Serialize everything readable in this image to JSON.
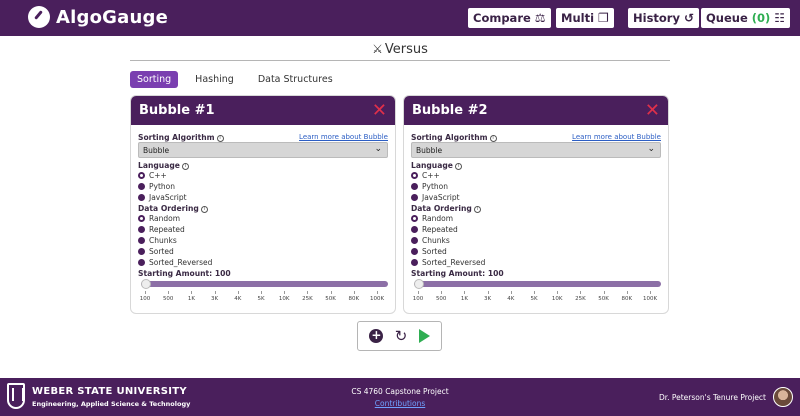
{
  "header": {
    "brand": "AlgoGauge",
    "nav": [
      {
        "label": "Compare",
        "icon": "scale-icon"
      },
      {
        "label": "Multi",
        "icon": "copy-icon"
      },
      {
        "label": "History",
        "icon": "history-icon"
      },
      {
        "label": "Queue",
        "count": "(0)",
        "icon": "queue-icon"
      }
    ]
  },
  "versus": {
    "label": "Versus",
    "icon": "swords-icon"
  },
  "tabs": [
    {
      "label": "Sorting",
      "active": true
    },
    {
      "label": "Hashing",
      "active": false
    },
    {
      "label": "Data Structures",
      "active": false
    }
  ],
  "cards": [
    {
      "title": "Bubble #1",
      "algorithm_label": "Sorting Algorithm",
      "learn_more": "Learn more about Bubble",
      "algorithm_value": "Bubble",
      "language_label": "Language",
      "languages": [
        "C++",
        "Python",
        "JavaScript"
      ],
      "selected_language": "C++",
      "ordering_label": "Data Ordering",
      "orderings": [
        "Random",
        "Repeated",
        "Chunks",
        "Sorted",
        "Sorted_Reversed"
      ],
      "selected_ordering": "Random",
      "amount_label": "Starting Amount: 100",
      "slider_value_index": 0
    },
    {
      "title": "Bubble #2",
      "algorithm_label": "Sorting Algorithm",
      "learn_more": "Learn more about Bubble",
      "algorithm_value": "Bubble",
      "language_label": "Language",
      "languages": [
        "C++",
        "Python",
        "JavaScript"
      ],
      "selected_language": "C++",
      "ordering_label": "Data Ordering",
      "orderings": [
        "Random",
        "Repeated",
        "Chunks",
        "Sorted",
        "Sorted_Reversed"
      ],
      "selected_ordering": "Random",
      "amount_label": "Starting Amount: 100",
      "slider_value_index": 0
    }
  ],
  "slider_ticks": [
    "100",
    "500",
    "1K",
    "3K",
    "4K",
    "5K",
    "10K",
    "25K",
    "50K",
    "80K",
    "100K"
  ],
  "controls": {
    "add": "+",
    "reset": "↻"
  },
  "footer": {
    "university": "WEBER STATE UNIVERSITY",
    "college": "Engineering, Applied Science & Technology",
    "project": "CS 4760 Capstone Project",
    "contributions": "Contributions",
    "tenure": "Dr. Peterson's Tenure Project"
  },
  "colors": {
    "primary": "#4a1f5c",
    "accent": "#7a3fb0",
    "close": "#e0304a",
    "play": "#2fae52",
    "link": "#2c5ec4"
  }
}
